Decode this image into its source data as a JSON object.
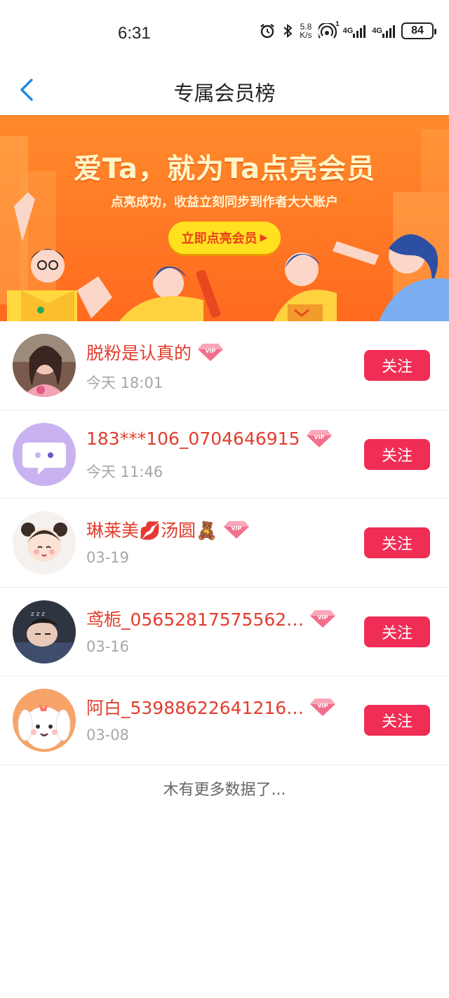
{
  "status_bar": {
    "time": "6:31",
    "speed_value": "5.8",
    "speed_unit": "K/s",
    "net1": "4G",
    "net2": "4G",
    "hotspot_badge": "1",
    "battery": "84"
  },
  "header": {
    "title": "专属会员榜",
    "back_icon": "chevron-left-icon",
    "accent": "#1e88e5"
  },
  "banner": {
    "headline": "爱Ta，就为Ta点亮会员",
    "subtitle": "点亮成功，收益立刻同步到作者大大账户",
    "cta": "立即点亮会员",
    "cta_icon": "▶"
  },
  "members": [
    {
      "name": "脱粉是认真的",
      "time": "今天  18:01",
      "vip": true,
      "follow_label": "关注",
      "avatar": "photo-girl"
    },
    {
      "name": "183***106_0704646915",
      "time": "今天  11:46",
      "vip": true,
      "follow_label": "关注",
      "avatar": "default-chat"
    },
    {
      "name": "琳莱美💋汤圆🧸",
      "time": "03-19",
      "vip": true,
      "follow_label": "关注",
      "avatar": "cartoon-girl"
    },
    {
      "name": "鸢栀_05652817575562…",
      "time": "03-16",
      "vip": true,
      "follow_label": "关注",
      "avatar": "photo-sleeping"
    },
    {
      "name": "阿白_53988622641216…",
      "time": "03-08",
      "vip": true,
      "follow_label": "关注",
      "avatar": "cartoon-dog"
    }
  ],
  "footer": {
    "no_more": "木有更多数据了..."
  },
  "colors": {
    "name": "#e23d2d",
    "follow_button": "#ef2d55",
    "banner": "#ff7a22",
    "cta": "#ffe11f"
  }
}
